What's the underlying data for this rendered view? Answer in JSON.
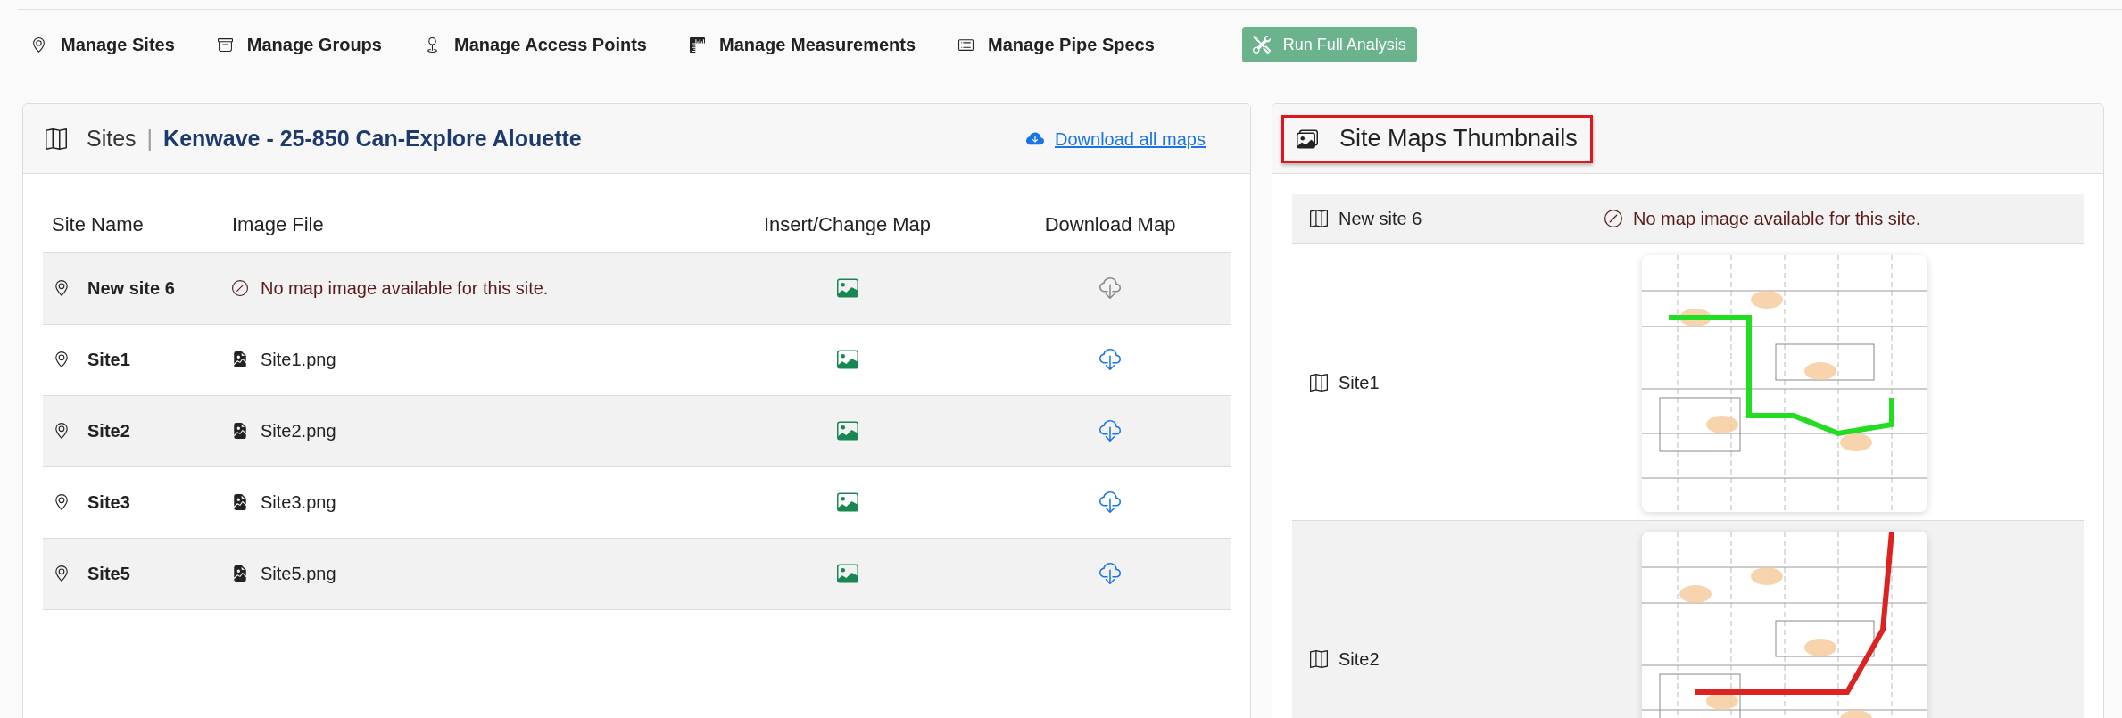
{
  "nav": {
    "items": [
      {
        "kind": "sites",
        "label": "Manage Sites"
      },
      {
        "kind": "groups",
        "label": "Manage Groups"
      },
      {
        "kind": "access_points",
        "label": "Manage Access Points"
      },
      {
        "kind": "measurements",
        "label": "Manage Measurements"
      },
      {
        "kind": "pipe_specs",
        "label": "Manage Pipe Specs"
      }
    ],
    "action_button": "Run Full Analysis"
  },
  "sites_panel": {
    "title": "Sites",
    "separator": "|",
    "project": "Kenwave - 25-850 Can-Explore Alouette",
    "download_all": "Download all maps",
    "columns": [
      "Site Name",
      "Image File",
      "Insert/Change Map",
      "Download Map"
    ],
    "rows": [
      {
        "kind": "no_map",
        "name": "New site 6",
        "file": "No map image available for this site."
      },
      {
        "kind": "map",
        "name": "Site1",
        "file": "Site1.png"
      },
      {
        "kind": "map",
        "name": "Site2",
        "file": "Site2.png"
      },
      {
        "kind": "map",
        "name": "Site3",
        "file": "Site3.png"
      },
      {
        "kind": "map",
        "name": "Site5",
        "file": "Site5.png"
      }
    ]
  },
  "thumbnails_panel": {
    "title": "Site Maps Thumbnails",
    "rows": [
      {
        "kind": "no_map",
        "name": "New site 6",
        "message": "No map image available for this site."
      },
      {
        "kind": "map",
        "name": "Site1",
        "color": "#22dd22"
      },
      {
        "kind": "map",
        "name": "Site2",
        "color": "#dd2222"
      }
    ]
  }
}
